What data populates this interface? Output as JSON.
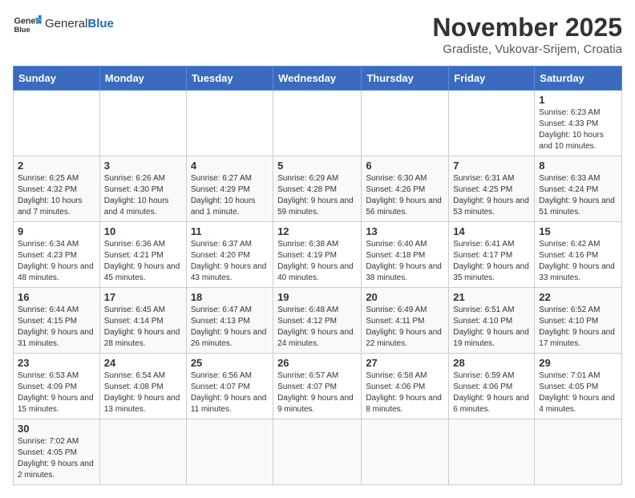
{
  "header": {
    "logo_text_normal": "General",
    "logo_text_bold": "Blue",
    "month_title": "November 2025",
    "location": "Gradiste, Vukovar-Srijem, Croatia"
  },
  "days_of_week": [
    "Sunday",
    "Monday",
    "Tuesday",
    "Wednesday",
    "Thursday",
    "Friday",
    "Saturday"
  ],
  "weeks": [
    [
      {
        "day": "",
        "info": ""
      },
      {
        "day": "",
        "info": ""
      },
      {
        "day": "",
        "info": ""
      },
      {
        "day": "",
        "info": ""
      },
      {
        "day": "",
        "info": ""
      },
      {
        "day": "",
        "info": ""
      },
      {
        "day": "1",
        "info": "Sunrise: 6:23 AM\nSunset: 4:33 PM\nDaylight: 10 hours and 10 minutes."
      }
    ],
    [
      {
        "day": "2",
        "info": "Sunrise: 6:25 AM\nSunset: 4:32 PM\nDaylight: 10 hours and 7 minutes."
      },
      {
        "day": "3",
        "info": "Sunrise: 6:26 AM\nSunset: 4:30 PM\nDaylight: 10 hours and 4 minutes."
      },
      {
        "day": "4",
        "info": "Sunrise: 6:27 AM\nSunset: 4:29 PM\nDaylight: 10 hours and 1 minute."
      },
      {
        "day": "5",
        "info": "Sunrise: 6:29 AM\nSunset: 4:28 PM\nDaylight: 9 hours and 59 minutes."
      },
      {
        "day": "6",
        "info": "Sunrise: 6:30 AM\nSunset: 4:26 PM\nDaylight: 9 hours and 56 minutes."
      },
      {
        "day": "7",
        "info": "Sunrise: 6:31 AM\nSunset: 4:25 PM\nDaylight: 9 hours and 53 minutes."
      },
      {
        "day": "8",
        "info": "Sunrise: 6:33 AM\nSunset: 4:24 PM\nDaylight: 9 hours and 51 minutes."
      }
    ],
    [
      {
        "day": "9",
        "info": "Sunrise: 6:34 AM\nSunset: 4:23 PM\nDaylight: 9 hours and 48 minutes."
      },
      {
        "day": "10",
        "info": "Sunrise: 6:36 AM\nSunset: 4:21 PM\nDaylight: 9 hours and 45 minutes."
      },
      {
        "day": "11",
        "info": "Sunrise: 6:37 AM\nSunset: 4:20 PM\nDaylight: 9 hours and 43 minutes."
      },
      {
        "day": "12",
        "info": "Sunrise: 6:38 AM\nSunset: 4:19 PM\nDaylight: 9 hours and 40 minutes."
      },
      {
        "day": "13",
        "info": "Sunrise: 6:40 AM\nSunset: 4:18 PM\nDaylight: 9 hours and 38 minutes."
      },
      {
        "day": "14",
        "info": "Sunrise: 6:41 AM\nSunset: 4:17 PM\nDaylight: 9 hours and 35 minutes."
      },
      {
        "day": "15",
        "info": "Sunrise: 6:42 AM\nSunset: 4:16 PM\nDaylight: 9 hours and 33 minutes."
      }
    ],
    [
      {
        "day": "16",
        "info": "Sunrise: 6:44 AM\nSunset: 4:15 PM\nDaylight: 9 hours and 31 minutes."
      },
      {
        "day": "17",
        "info": "Sunrise: 6:45 AM\nSunset: 4:14 PM\nDaylight: 9 hours and 28 minutes."
      },
      {
        "day": "18",
        "info": "Sunrise: 6:47 AM\nSunset: 4:13 PM\nDaylight: 9 hours and 26 minutes."
      },
      {
        "day": "19",
        "info": "Sunrise: 6:48 AM\nSunset: 4:12 PM\nDaylight: 9 hours and 24 minutes."
      },
      {
        "day": "20",
        "info": "Sunrise: 6:49 AM\nSunset: 4:11 PM\nDaylight: 9 hours and 22 minutes."
      },
      {
        "day": "21",
        "info": "Sunrise: 6:51 AM\nSunset: 4:10 PM\nDaylight: 9 hours and 19 minutes."
      },
      {
        "day": "22",
        "info": "Sunrise: 6:52 AM\nSunset: 4:10 PM\nDaylight: 9 hours and 17 minutes."
      }
    ],
    [
      {
        "day": "23",
        "info": "Sunrise: 6:53 AM\nSunset: 4:09 PM\nDaylight: 9 hours and 15 minutes."
      },
      {
        "day": "24",
        "info": "Sunrise: 6:54 AM\nSunset: 4:08 PM\nDaylight: 9 hours and 13 minutes."
      },
      {
        "day": "25",
        "info": "Sunrise: 6:56 AM\nSunset: 4:07 PM\nDaylight: 9 hours and 11 minutes."
      },
      {
        "day": "26",
        "info": "Sunrise: 6:57 AM\nSunset: 4:07 PM\nDaylight: 9 hours and 9 minutes."
      },
      {
        "day": "27",
        "info": "Sunrise: 6:58 AM\nSunset: 4:06 PM\nDaylight: 9 hours and 8 minutes."
      },
      {
        "day": "28",
        "info": "Sunrise: 6:59 AM\nSunset: 4:06 PM\nDaylight: 9 hours and 6 minutes."
      },
      {
        "day": "29",
        "info": "Sunrise: 7:01 AM\nSunset: 4:05 PM\nDaylight: 9 hours and 4 minutes."
      }
    ],
    [
      {
        "day": "30",
        "info": "Sunrise: 7:02 AM\nSunset: 4:05 PM\nDaylight: 9 hours and 2 minutes."
      },
      {
        "day": "",
        "info": ""
      },
      {
        "day": "",
        "info": ""
      },
      {
        "day": "",
        "info": ""
      },
      {
        "day": "",
        "info": ""
      },
      {
        "day": "",
        "info": ""
      },
      {
        "day": "",
        "info": ""
      }
    ]
  ]
}
